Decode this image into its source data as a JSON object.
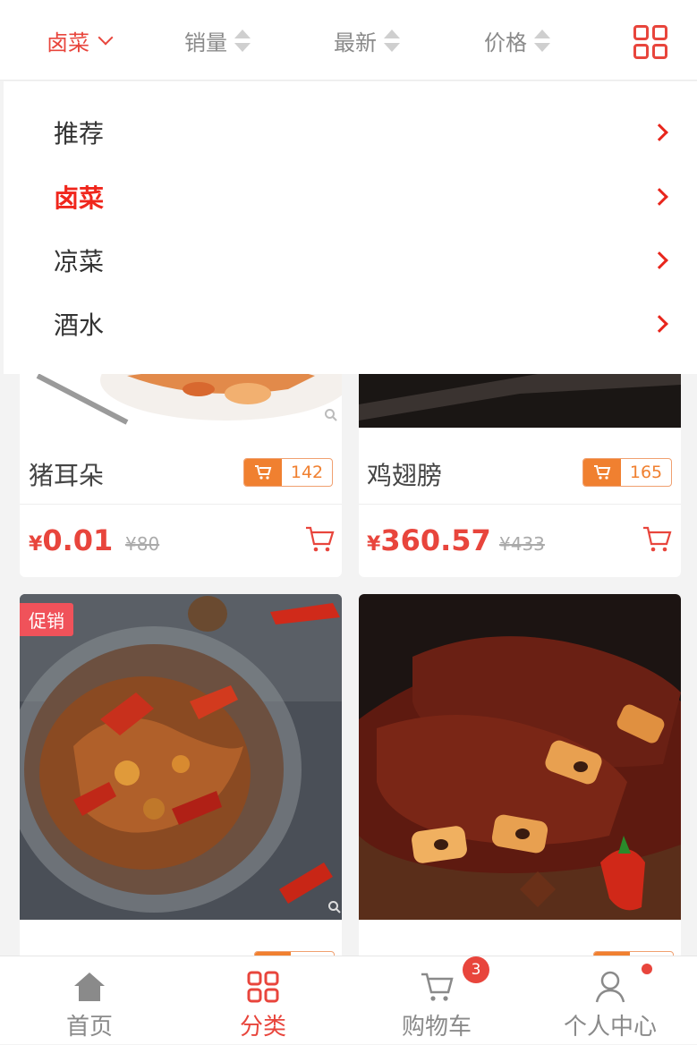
{
  "filter_bar": {
    "category_label": "卤菜",
    "sales_label": "销量",
    "newest_label": "最新",
    "price_label": "价格"
  },
  "dropdown": {
    "items": [
      {
        "label": "推荐"
      },
      {
        "label": "卤菜"
      },
      {
        "label": "凉菜"
      },
      {
        "label": "酒水"
      }
    ],
    "selected_index": 1
  },
  "products": [
    {
      "name": "猪耳朵",
      "sales": "142",
      "yen": "¥",
      "price": "0.01",
      "old_price": "¥80"
    },
    {
      "name": "鸡翅膀",
      "sales": "165",
      "yen": "¥",
      "price": "360.57",
      "old_price": "¥433"
    },
    {
      "promo_tag": "促销"
    }
  ],
  "tabbar": {
    "tabs": [
      {
        "label": "首页",
        "icon": "home-icon"
      },
      {
        "label": "分类",
        "icon": "grid-icon"
      },
      {
        "label": "购物车",
        "icon": "cart-icon",
        "badge": "3"
      },
      {
        "label": "个人中心",
        "icon": "user-icon"
      }
    ],
    "active_index": 1
  },
  "colors": {
    "accent": "#e8453c",
    "sales_badge": "#f08030",
    "promo": "#f0525a"
  }
}
